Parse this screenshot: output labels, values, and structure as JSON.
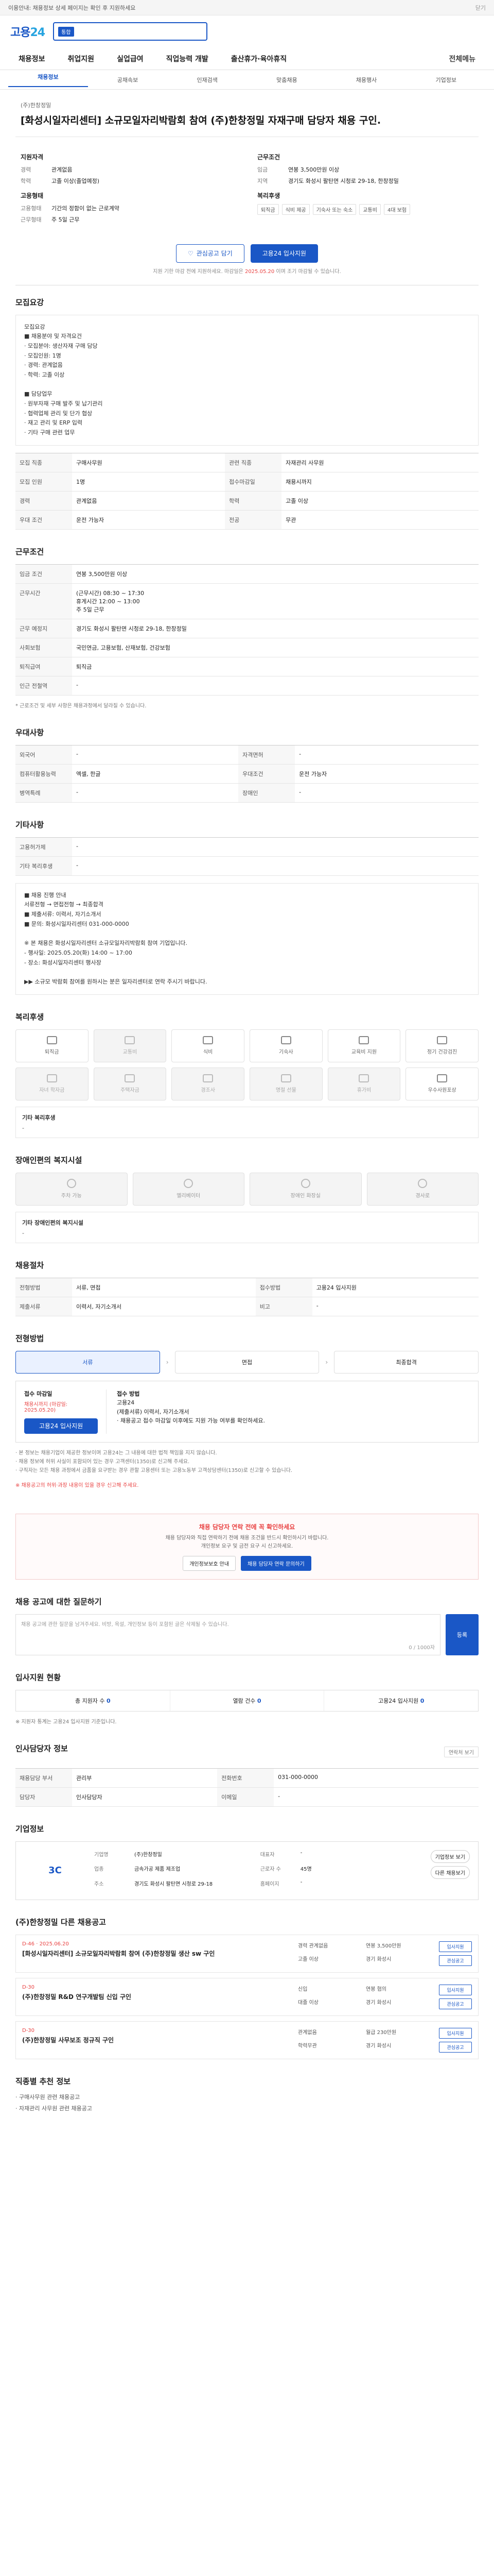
{
  "notice": {
    "text": "이용안내: 채용정보 상세 페이지는 확인 후 지원하세요",
    "close": "닫기"
  },
  "brand": {
    "logo_main": "고용",
    "logo_sub": "24"
  },
  "search": {
    "tag": "통합",
    "placeholder": ""
  },
  "menu": {
    "items": [
      "채용정보",
      "취업지원",
      "실업급여",
      "직업능력 개발",
      "출산휴가·육아휴직"
    ],
    "right": "전체메뉴"
  },
  "submenu": {
    "items": [
      "채용정보",
      "공채속보",
      "인재검색",
      "맞춤채용",
      "채용행사",
      "기업정보"
    ],
    "active_index": 0
  },
  "job": {
    "company": "(주)한창정밀",
    "title": "[화성시일자리센터] 소규모일자리박람회 참여 (주)한창정밀 자재구매 담당자 채용 구인.",
    "left_title": "지원자격",
    "left_rows": [
      [
        "경력",
        "관계없음"
      ],
      [
        "학력",
        "고졸 이상(졸업예정)"
      ]
    ],
    "left_title2": "고용형태",
    "left_rows2": [
      [
        "고용형태",
        "기간의 정함이 없는 근로계약"
      ],
      [
        "근무형태",
        "주 5일 근무"
      ]
    ],
    "right_title": "근무조건",
    "right_rows": [
      [
        "임금",
        "연봉 3,500만원 이상"
      ],
      [
        "지역",
        "경기도 화성시 팔탄면 시청로 29-18, 한창정밀"
      ]
    ],
    "right_title2": "복리후생",
    "chips": [
      "퇴직금",
      "식비 제공",
      "기숙사 또는 숙소",
      "교통비",
      "4대 보험"
    ],
    "btn_scrap": "관심공고 담기",
    "btn_apply": "고용24 입사지원",
    "note_prefix": "지원 기한 마감 전에 지원하세요. 마감일은",
    "note_red": "2025.05.20",
    "note_suffix": "이며 조기 마감될 수 있습니다."
  },
  "duty": {
    "title": "모집요강",
    "text": "모집요강\n■ 채용분야 및 자격요건\n · 모집분야: 생산자재 구매 담당\n · 모집인원: 1명\n · 경력: 관계없음\n · 학력: 고졸 이상\n\n■ 담당업무\n · 원부자재 구매 발주 및 납기관리\n · 협력업체 관리 및 단가 협상\n · 재고 관리 및 ERP 입력\n · 기타 구매 관련 업무"
  },
  "duty_table": [
    [
      "모집 직종",
      "구매사무원"
    ],
    [
      "관련 직종",
      "자재관리 사무원"
    ],
    [
      "모집 인원",
      "1명"
    ],
    [
      "접수마감일",
      "채용시까지"
    ],
    [
      "경력",
      "관계없음"
    ],
    [
      "학력",
      "고졸 이상"
    ],
    [
      "우대 조건",
      "운전 가능자"
    ],
    [
      "전공",
      "무관"
    ]
  ],
  "work": {
    "title": "근무조건",
    "rows": [
      [
        "임금 조건",
        "연봉 3,500만원 이상"
      ],
      [
        "근무시간",
        "(근무시간) 08:30 ~ 17:30\n휴게시간 12:00 ~ 13:00\n주 5일 근무"
      ],
      [
        "근무 예정지",
        "경기도 화성시 팔탄면 시청로 29-18, 한창정밀"
      ],
      [
        "사회보험",
        "국민연금, 고용보험, 산재보험, 건강보험"
      ],
      [
        "퇴직급여",
        "퇴직금"
      ],
      [
        "인근 전철역",
        "-"
      ]
    ],
    "foot": "* 근로조건 및 세부 사항은 채용과정에서 달라질 수 있습니다."
  },
  "prefer": {
    "title": "우대사항",
    "rows": [
      [
        "외국어",
        "-"
      ],
      [
        "자격면허",
        "-"
      ],
      [
        "컴퓨터활용능력",
        "엑셀, 한글"
      ],
      [
        "우대조건",
        "운전 가능자"
      ],
      [
        "병역특례",
        "-"
      ],
      [
        "장애인",
        "-"
      ]
    ]
  },
  "etc": {
    "title": "기타사항",
    "rows": [
      [
        "고용허가제",
        "-"
      ],
      [
        "기타 복리후생",
        "-"
      ]
    ],
    "text": "■ 채용 진행 안내\n 서류전형 → 면접전형 → 최종합격\n■ 제출서류: 이력서, 자기소개서\n■ 문의: 화성시일자리센터 031-000-0000\n\n※ 본 채용은 화성시일자리센터 소규모일자리박람회 참여 기업입니다.\n  - 행사일: 2025.05.20(화) 14:00 ~ 17:00\n  - 장소: 화성시일자리센터 행사장\n\n▶▶ 소규모 박람회 참여를 원하시는 분은 일자리센터로 연락 주시기 바랍니다."
  },
  "welfare": {
    "title": "복리후생",
    "items": [
      {
        "label": "퇴직금",
        "on": true
      },
      {
        "label": "교통비",
        "on": false
      },
      {
        "label": "식비",
        "on": true
      },
      {
        "label": "기숙사",
        "on": true
      },
      {
        "label": "교육비 지원",
        "on": true
      },
      {
        "label": "정기 건강검진",
        "on": true
      },
      {
        "label": "자녀 학자금",
        "on": false
      },
      {
        "label": "주택자금",
        "on": false
      },
      {
        "label": "경조사",
        "on": false
      },
      {
        "label": "명절 선물",
        "on": false
      },
      {
        "label": "휴가비",
        "on": false
      },
      {
        "label": "우수사원포상",
        "on": true
      }
    ],
    "etc_title": "기타 복리후생",
    "etc_value": "-"
  },
  "disabled": {
    "title": "장애인편의 복지시설",
    "items": [
      "주차 가능",
      "엘리베이터",
      "장애인 화장실",
      "경사로"
    ],
    "etc_title": "기타 장애인편의 복지시설",
    "etc_value": "-"
  },
  "recruit_method": {
    "title": "채용절차",
    "rows": [
      [
        "전형방법",
        "서류, 면접"
      ],
      [
        "접수방법",
        "고용24 입사지원"
      ],
      [
        "제출서류",
        "이력서, 자기소개서"
      ],
      [
        "비고",
        "-"
      ]
    ]
  },
  "process": {
    "title": "전형방법",
    "steps": [
      "서류",
      "면접",
      "최종합격"
    ],
    "active_index": 0
  },
  "apply": {
    "left_title": "접수 마감일",
    "left_date": "채용시까지 (마감일: 2025.05.20)",
    "left_btn": "고용24 입사지원",
    "right_title": "접수 방법",
    "right_text": "고용24\n(제출서류) 이력서, 자기소개서\n· 채용공고 접수 마감일 이후에도 지원 가능 여부를 확인하세요.",
    "notes": [
      "· 본 정보는 채용기업이 제공한 정보이며 고용24는 그 내용에 대한 법적 책임을 지지 않습니다.",
      "· 채용 정보에 허위 사실이 포함되어 있는 경우 고객센터(1350)로 신고해 주세요.",
      "· 구직자는 모든 채용 과정에서 금품을 요구받는 경우 관할 고용센터 또는 고용노동부 고객상담센터(1350)로 신고할 수 있습니다."
    ],
    "red_note": "※ 채용공고의 허위·과장 내용이 있을 경우 신고해 주세요."
  },
  "alert": {
    "title": "채용 담당자 연락 전에 꼭 확인하세요",
    "text": "채용 담당자와 직접 연락하기 전에 채용 조건을 반드시 확인하시기 바랍니다.\n개인정보 요구 및 금전 요구 시 신고하세요.",
    "btn1": "개인정보보호 안내",
    "btn2": "채용 담당자 연락 문의하기"
  },
  "qna": {
    "title": "채용 공고에 대한 질문하기",
    "placeholder": "채용 공고에 관한 질문을 남겨주세요. 비방, 욕설, 개인정보 등이 포함된 글은 삭제될 수 있습니다.",
    "count": "0 / 1000자",
    "btn": "등록"
  },
  "stats": {
    "title": "입사지원 현황",
    "items": [
      [
        "총 지원자 수",
        "0"
      ],
      [
        "열람 건수",
        "0"
      ],
      [
        "고용24 입사지원",
        "0"
      ]
    ],
    "note": "※ 지원자 통계는 고용24 입사지원 기준입니다."
  },
  "manager": {
    "title": "인사담당자 정보",
    "rows": [
      [
        "채용담당 부서",
        "관리부"
      ],
      [
        "전화번호",
        "031-000-0000"
      ],
      [
        "담당자",
        "인사담당자"
      ],
      [
        "이메일",
        "-"
      ]
    ],
    "btn": "연락처 보기"
  },
  "company": {
    "title": "기업정보",
    "logo": "3C",
    "rows": [
      [
        "기업명",
        "(주)한창정밀"
      ],
      [
        "대표자",
        "-"
      ],
      [
        "업종",
        "금속가공 제품 제조업"
      ],
      [
        "근로자 수",
        "45명"
      ],
      [
        "주소",
        "경기도 화성시 팔탄면 시청로 29-18"
      ],
      [
        "홈페이지",
        "-"
      ]
    ],
    "side": [
      "기업정보 보기",
      "다른 채용보기"
    ]
  },
  "others": {
    "title": "(주)한창정밀 다른 채용공고",
    "items": [
      {
        "dday": "D-46 · 2025.06.20",
        "title": "[화성시일자리센터] 소규모일자리박람회 참여 (주)한창정밀 생산 sw 구인",
        "meta": [
          "경력 관계없음",
          "연봉 3,500만원",
          "고졸 이상",
          "경기 화성시"
        ],
        "btns": [
          "입사지원",
          "관심공고"
        ]
      },
      {
        "dday": "D-30",
        "title": "(주)한창정밀 R&D 연구개발팀 신입 구인",
        "meta": [
          "신입",
          "연봉 협의",
          "대졸 이상",
          "경기 화성시"
        ],
        "btns": [
          "입사지원",
          "관심공고"
        ]
      },
      {
        "dday": "D-30",
        "title": "(주)한창정밀 사무보조 정규직 구인",
        "meta": [
          "관계없음",
          "월급 230만원",
          "학력무관",
          "경기 화성시"
        ],
        "btns": [
          "입사지원",
          "관심공고"
        ]
      }
    ]
  },
  "footer": {
    "title": "직종별 추천 정보",
    "items": [
      "· 구매사무원 관련 채용공고",
      "· 자재관리 사무원 관련 채용공고"
    ]
  }
}
